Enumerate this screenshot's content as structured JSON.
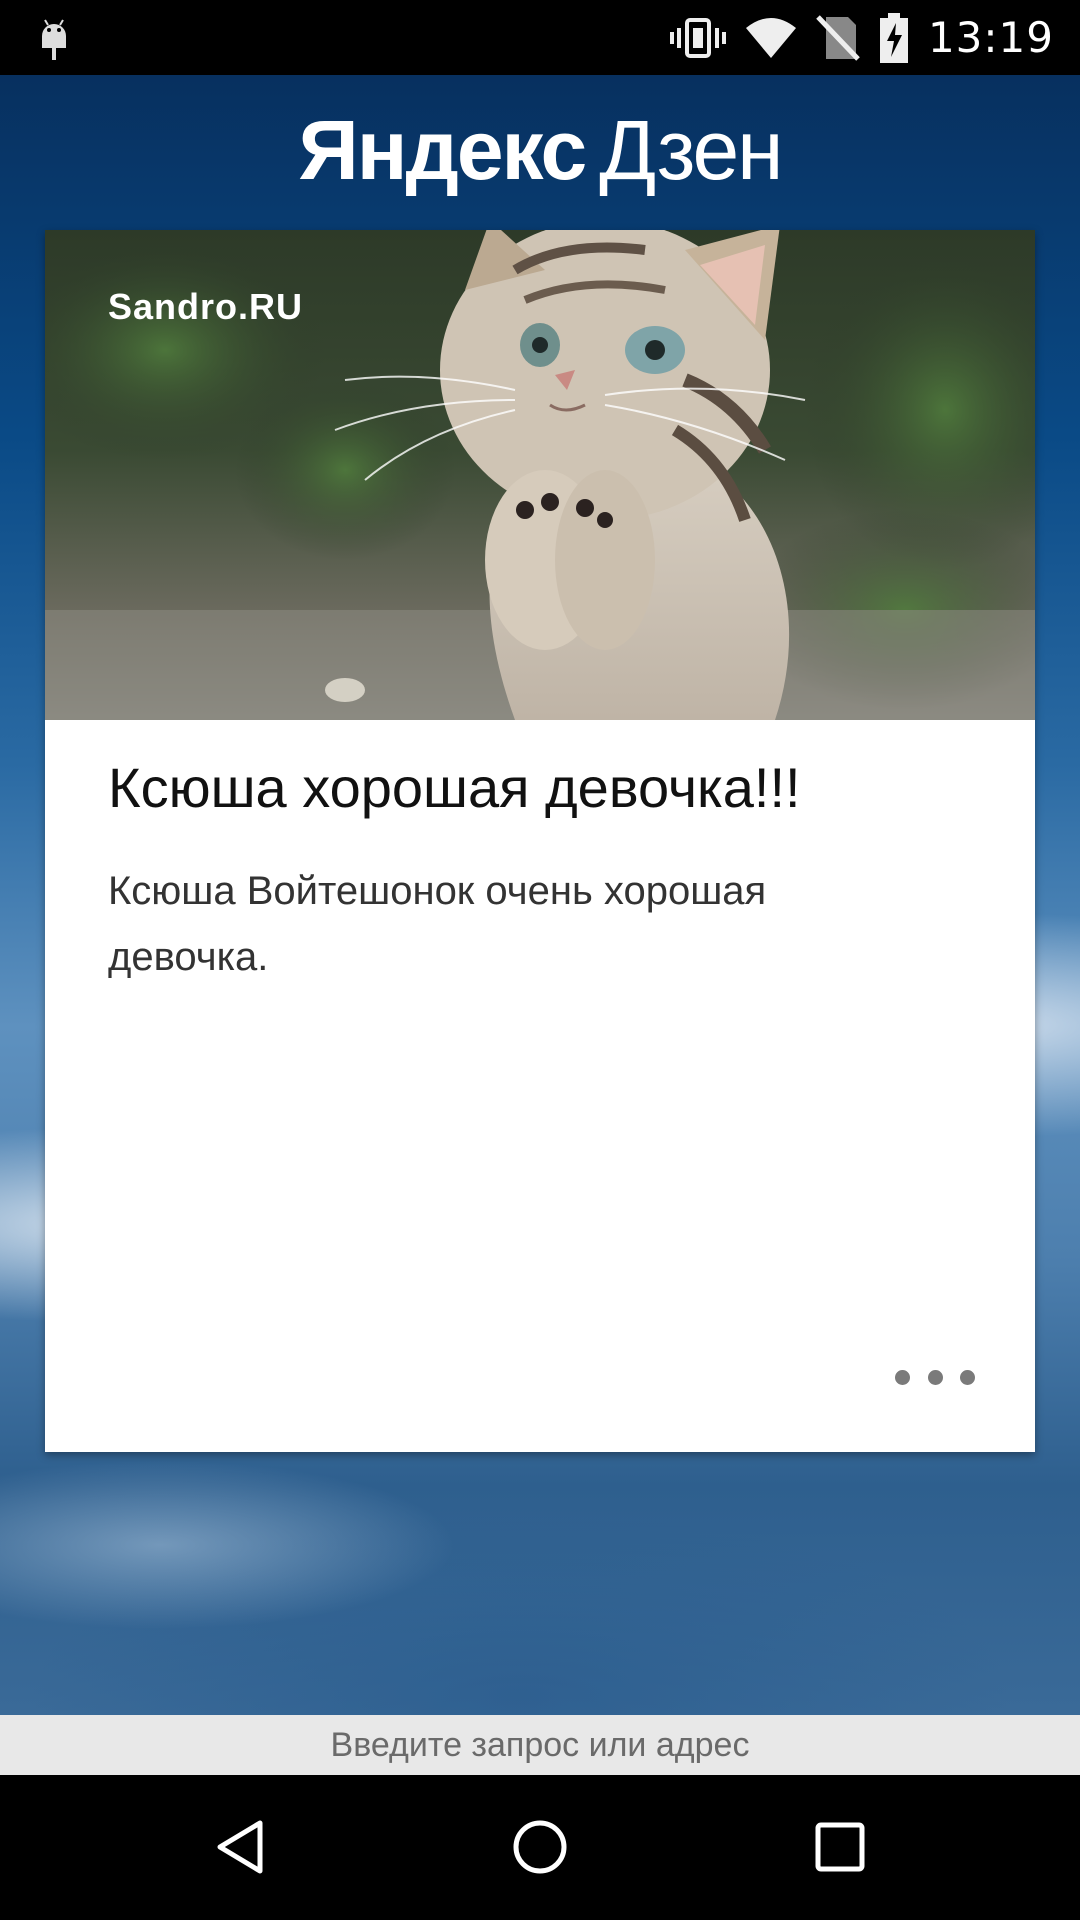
{
  "status_bar": {
    "time": "13:19",
    "icons": [
      "android-debug-icon",
      "vibrate-icon",
      "wifi-icon",
      "no-sim-icon",
      "battery-charging-icon"
    ]
  },
  "header": {
    "logo_brand": "Яндекс",
    "logo_product": "Дзен"
  },
  "card": {
    "source": "Sandro.RU",
    "title": "Ксюша хорошая девочка!!!",
    "description": "Ксюша Войтешонок очень хорошая девочка.",
    "image": "kitten-photo",
    "menu_icon": "more-horizontal-icon"
  },
  "address_bar": {
    "placeholder": "Введите запрос или адрес",
    "value": ""
  },
  "nav_bar": {
    "buttons": [
      "back-icon",
      "home-icon",
      "recents-icon"
    ]
  },
  "colors": {
    "background_top": "#07305f",
    "background_mid": "#5e91bf",
    "card": "#ffffff",
    "status_bar": "#000000",
    "address_bar": "#e8e8e8"
  }
}
